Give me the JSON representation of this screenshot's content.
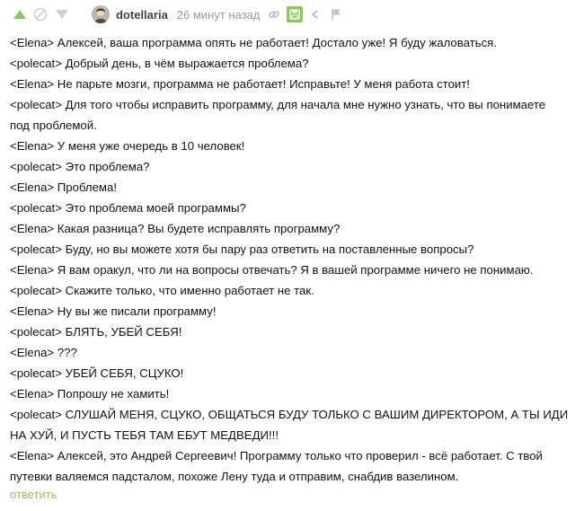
{
  "header": {
    "username": "dotellaria",
    "timestamp": "26 минут назад",
    "icons": {
      "vote_up": "arrow-up-icon",
      "vote_down": "arrow-down-icon",
      "rating": "circle-slash-icon",
      "link": "link-icon",
      "save": "save-icon",
      "more": "chevron-left-icon",
      "flag": "flag-icon"
    }
  },
  "colors": {
    "accent": "#8ac858",
    "vote": "#8ac858",
    "muted": "#cfcfcf",
    "text": "#111111"
  },
  "lines": [
    "<Elena> Алексей, ваша программа опять не работает! Достало уже! Я буду жаловаться.",
    "<polecat> Добрый день, в чём выражается проблема?",
    "<Elena> Не парьте мозги, программа не работает! Исправьте! У меня работа стоит!",
    "<polecat> Для того чтобы исправить программу, для начала мне нужно узнать, что вы понимаете",
    "под проблемой.",
    "<Elena> У меня уже очередь в 10 человек!",
    "<polecat> Это проблема?",
    "<Elena> Проблема!",
    "<polecat> Это проблема моей программы?",
    "<Elena> Какая разница? Вы будете исправлять программу?",
    "<polecat> Буду, но вы можете хотя бы пару раз ответить на поставленные вопросы?",
    "<Elena> Я вам оракул, что ли на вопросы отвечать? Я в вашей программе ничего не понимаю.",
    "<polecat> Скажите только, что именно работает не так.",
    "<Elena> Ну вы же писали программу!",
    "<polecat> БЛЯТЬ, УБЕЙ СЕБЯ!",
    "<Elena> ???",
    "<polecat> УБЕЙ СЕБЯ, СЦУКО!",
    "<Elena> Попрошу не хамить!",
    "<polecat> СЛУШАЙ МЕНЯ, СЦУКО, ОБЩАТЬСЯ БУДУ ТОЛЬКО С ВАШИМ ДИРЕКТОРОМ, А ТЫ ИДИ",
    "НА ХУЙ, И ПУСТЬ ТЕБЯ ТАМ ЕБУТ МЕДВЕДИ!!!",
    "<Elena> Алексей, это Андрей Сергеевич! Программу только что проверил - всё работает. С твой",
    "путевки валяемся падсталом, похоже Лену туда и отправим, снабдив вазелином."
  ],
  "reply_label": "ответить"
}
